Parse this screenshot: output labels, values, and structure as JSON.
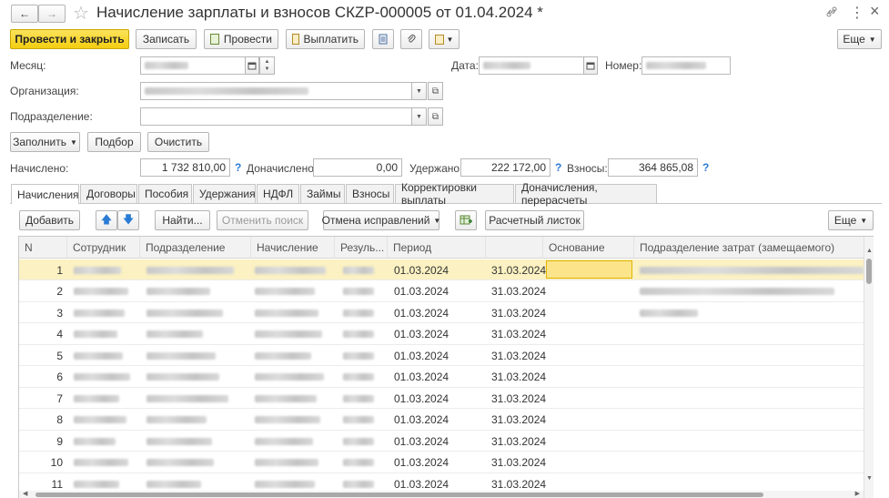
{
  "title_bar": {
    "title": "Начисление зарплаты и взносов СКZP-000005 от 01.04.2024 *",
    "back_glyph": "←",
    "forward_glyph": "→",
    "star_glyph": "☆",
    "link_glyph": "🔗",
    "menu_glyph": "⋮",
    "close_glyph": "×"
  },
  "toolbar": {
    "post_close": "Провести и закрыть",
    "save": "Записать",
    "post": "Провести",
    "pay": "Выплатить",
    "more": "Еще"
  },
  "form": {
    "month_label": "Месяц:",
    "date_label": "Дата:",
    "number_label": "Номер:",
    "org_label": "Организация:",
    "dept_label": "Подразделение:",
    "fill_button": "Заполнить",
    "select_button": "Подбор",
    "clear_button": "Очистить",
    "accrued_label": "Начислено:",
    "accrued_value": "1 732 810,00",
    "additional_label": "Доначислено:",
    "additional_value": "0,00",
    "withheld_label": "Удержано:",
    "withheld_value": "222 172,00",
    "contrib_label": "Взносы:",
    "contrib_value": "364 865,08",
    "help_glyph": "?"
  },
  "tabs": [
    {
      "label": "Начисления"
    },
    {
      "label": "Договоры"
    },
    {
      "label": "Пособия"
    },
    {
      "label": "Удержания"
    },
    {
      "label": "НДФЛ"
    },
    {
      "label": "Займы"
    },
    {
      "label": "Взносы"
    },
    {
      "label": "Корректировки выплаты"
    },
    {
      "label": "Доначисления, перерасчеты"
    }
  ],
  "table_toolbar": {
    "add": "Добавить",
    "find": "Найти...",
    "cancel_search": "Отменить поиск",
    "cancel_corrections": "Отмена исправлений",
    "payslip": "Расчетный листок",
    "more": "Еще"
  },
  "table": {
    "columns": [
      "N",
      "Сотрудник",
      "Подразделение",
      "Начисление",
      "Резуль...",
      "Период",
      "",
      "Основание",
      "Подразделение затрат (замещаемого)"
    ],
    "rows": [
      {
        "n": "1",
        "from": "01.03.2024",
        "to": "31.03.2024"
      },
      {
        "n": "2",
        "from": "01.03.2024",
        "to": "31.03.2024"
      },
      {
        "n": "3",
        "from": "01.03.2024",
        "to": "31.03.2024"
      },
      {
        "n": "4",
        "from": "01.03.2024",
        "to": "31.03.2024"
      },
      {
        "n": "5",
        "from": "01.03.2024",
        "to": "31.03.2024"
      },
      {
        "n": "6",
        "from": "01.03.2024",
        "to": "31.03.2024"
      },
      {
        "n": "7",
        "from": "01.03.2024",
        "to": "31.03.2024"
      },
      {
        "n": "8",
        "from": "01.03.2024",
        "to": "31.03.2024"
      },
      {
        "n": "9",
        "from": "01.03.2024",
        "to": "31.03.2024"
      },
      {
        "n": "10",
        "from": "01.03.2024",
        "to": "31.03.2024"
      },
      {
        "n": "11",
        "from": "01.03.2024",
        "to": "31.03.2024"
      }
    ]
  },
  "colors": {
    "accent_yellow": "#f4cd10",
    "selected_row": "#fbf1c2",
    "help_blue": "#2a7bd4"
  }
}
